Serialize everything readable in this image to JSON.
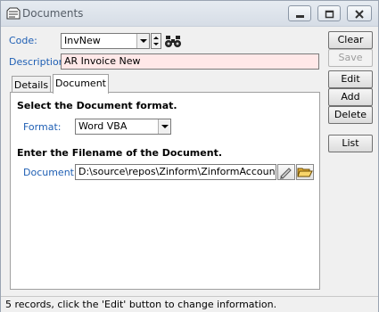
{
  "window": {
    "title": "Documents"
  },
  "form": {
    "code_label": "Code:",
    "code_value": "InvNew",
    "description_label": "Description:",
    "description_value": "AR Invoice New"
  },
  "tabs": [
    {
      "label": "Details",
      "active": false
    },
    {
      "label": "Document",
      "active": true
    }
  ],
  "document_tab": {
    "format_heading": "Select the Document format.",
    "format_label": "Format:",
    "format_value": "Word VBA",
    "filename_heading": "Enter the Filename of the Document.",
    "document_label": "Document:",
    "document_value": "D:\\source\\repos\\Zinform\\ZinformAccounts\\Zinform"
  },
  "buttons": {
    "clear": "Clear",
    "save": "Save",
    "edit": "Edit",
    "add": "Add",
    "delete": "Delete",
    "list": "List"
  },
  "status": {
    "text": "5 records, click the 'Edit' button to change information."
  },
  "colors": {
    "label_blue": "#1f5fb4",
    "pink_field": "#ffe8e8"
  }
}
